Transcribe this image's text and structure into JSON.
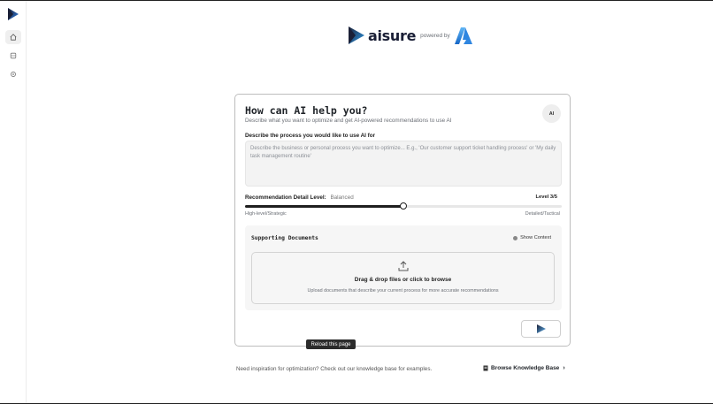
{
  "brand": {
    "name": "aisure",
    "powered_by": "powered by"
  },
  "sidebar": {
    "items": [
      {
        "icon": "home-icon",
        "active": true
      },
      {
        "icon": "grid-icon",
        "active": false
      },
      {
        "icon": "settings-icon",
        "active": false
      }
    ]
  },
  "card": {
    "title": "How can AI help you?",
    "subtitle": "Describe what you want to optimize and get AI-powered recommendations to use AI",
    "badge": "AI",
    "process_label": "Describe the process you would like to use AI for",
    "process_placeholder": "Describe the business or personal process you want to optimize... E.g., 'Our customer support ticket handling process' or 'My daily task management routine'",
    "detail_label": "Recommendation Detail Level:",
    "detail_value": "Balanced",
    "level_text": "Level 3/5",
    "slider": {
      "value": 3,
      "min": 1,
      "max": 5,
      "fraction": 0.5
    },
    "slider_min_label": "High-level/Strategic",
    "slider_max_label": "Detailed/Tactical",
    "docs": {
      "title": "Supporting Documents",
      "show_context": "Show Context",
      "drop_main": "Drag & drop files or click to browse",
      "drop_sub": "Upload documents that describe your current process for more accurate recommendations"
    }
  },
  "tooltip": "Reload this page",
  "footer": {
    "text": "Need inspiration for optimization? Check out our knowledge base for examples.",
    "kb_link": "Browse Knowledge Base"
  },
  "colors": {
    "brand_blue": "#2f7de1",
    "brand_dark": "#1a1f36",
    "accent_black": "#1f1f1f"
  }
}
